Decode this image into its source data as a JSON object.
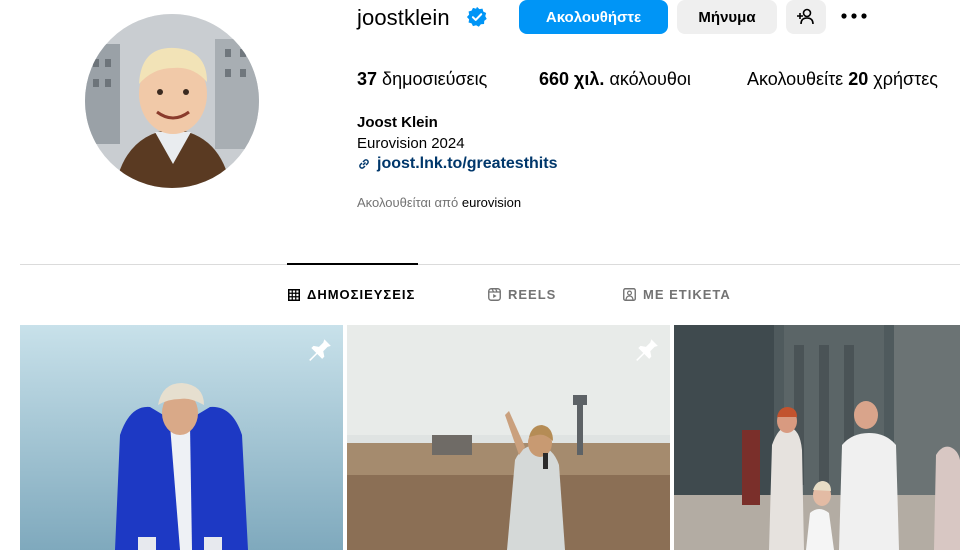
{
  "profile": {
    "username": "joostklein",
    "verified": true,
    "buttons": {
      "follow": "Ακολουθήστε",
      "message": "Μήνυμα"
    },
    "stats": {
      "posts_count": "37",
      "posts_label": "δημοσιεύσεις",
      "followers_count": "660 χιλ.",
      "followers_label": "ακόλουθοι",
      "following_prefix": "Ακολουθείτε",
      "following_count": "20",
      "following_label": "χρήστες"
    },
    "bio": {
      "name": "Joost Klein",
      "line": "Eurovision 2024",
      "link": "joost.lnk.to/greatesthits"
    },
    "followed_by_prefix": "Ακολουθείται από",
    "followed_by_user": "eurovision"
  },
  "tabs": [
    {
      "label": "ΔΗΜΟΣΙΕΥΣΕΙΣ",
      "active": true,
      "icon": "grid-icon"
    },
    {
      "label": "REELS",
      "active": false,
      "icon": "reels-icon"
    },
    {
      "label": "ΜΕ ΕΤΙΚΕΤΑ",
      "active": false,
      "icon": "tagged-icon"
    }
  ],
  "colors": {
    "accent": "#0095f6",
    "link": "#00376b",
    "muted": "#737373",
    "button_gray": "#efefef",
    "divider": "#dbdbdb"
  }
}
